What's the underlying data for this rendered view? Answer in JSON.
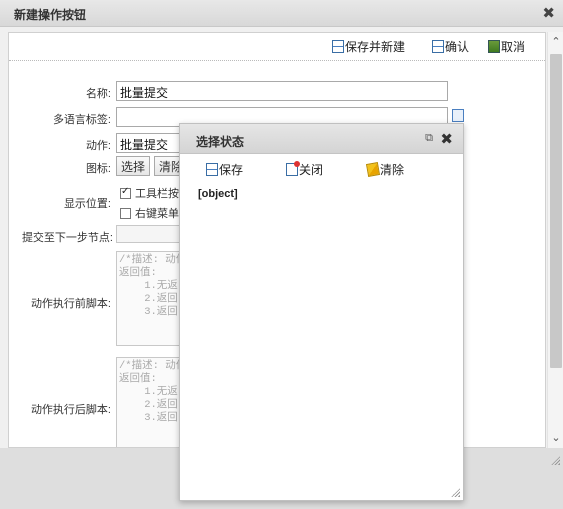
{
  "dialog": {
    "title": "新建操作按钮",
    "close": "✖"
  },
  "toolbar": {
    "save_new": "保存并新建",
    "confirm": "确认",
    "cancel": "取消"
  },
  "form": {
    "name_label": "名称:",
    "name_value": "批量提交",
    "i18n_label": "多语言标签:",
    "i18n_value": "",
    "action_label": "动作:",
    "action_value": "批量提交",
    "icon_label": "图标:",
    "icon_select": "选择",
    "icon_clear": "清除",
    "position_label": "显示位置:",
    "position_toolbar": "工具栏按",
    "position_toolbar_checked": true,
    "position_context": "右键菜单",
    "position_context_checked": false,
    "next_node_label": "提交至下一步节点:",
    "next_node_value": "",
    "before_label": "动作执行前脚本:",
    "before_script": "/*描述: 动作\n返回值:\n    1.无返\n    2.返回\n    3.返回",
    "after_label": "动作执行后脚本:",
    "after_script": "/*描述: 动作\n返回值:\n    1.无返\n    2.返回\n    3.返回"
  },
  "popup": {
    "title": "选择状态",
    "popout": "⧉",
    "close": "✖",
    "save": "保存",
    "close_btn": "关闭",
    "clear": "清除",
    "body": "[object]"
  },
  "scroll": {
    "up": "⌃",
    "down": "⌄"
  }
}
